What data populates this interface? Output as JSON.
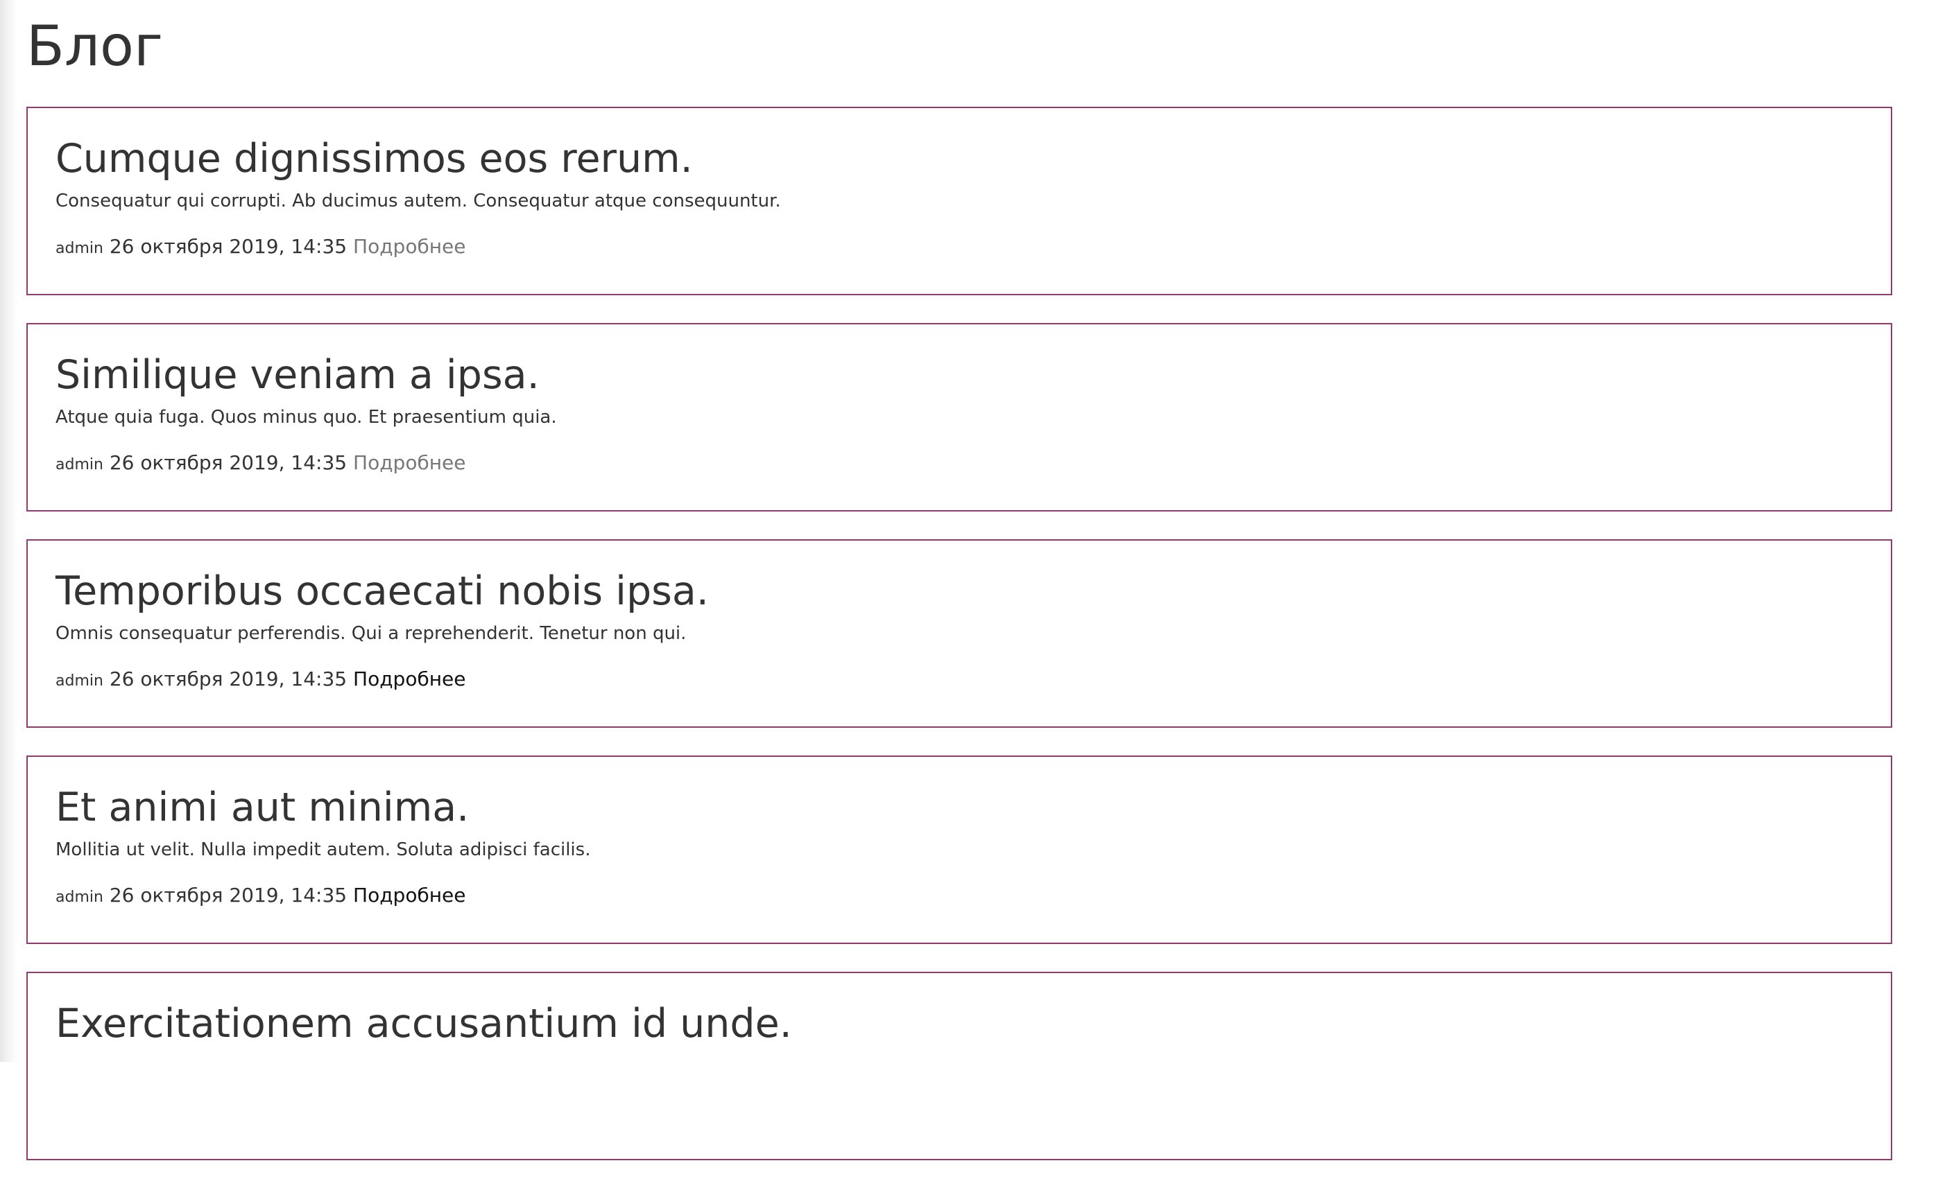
{
  "page": {
    "title": "Блог"
  },
  "posts": [
    {
      "title": "Cumque dignissimos eos rerum.",
      "excerpt": "Consequatur qui corrupti. Ab ducimus autem. Consequatur atque consequuntur.",
      "author": "admin",
      "date": "26 октября 2019, 14:35",
      "more_label": "Подробнее",
      "more_color": "#777777"
    },
    {
      "title": "Similique veniam a ipsa.",
      "excerpt": "Atque quia fuga. Quos minus quo. Et praesentium quia.",
      "author": "admin",
      "date": "26 октября 2019, 14:35",
      "more_label": "Подробнее",
      "more_color": "#777777"
    },
    {
      "title": "Temporibus occaecati nobis ipsa.",
      "excerpt": "Omnis consequatur perferendis. Qui a reprehenderit. Tenetur non qui.",
      "author": "admin",
      "date": "26 октября 2019, 14:35",
      "more_label": "Подробнее",
      "more_color": "#111111"
    },
    {
      "title": "Et animi aut minima.",
      "excerpt": "Mollitia ut velit. Nulla impedit autem. Soluta adipisci facilis.",
      "author": "admin",
      "date": "26 октября 2019, 14:35",
      "more_label": "Подробнее",
      "more_color": "#111111"
    },
    {
      "title": "Exercitationem accusantium id unde.",
      "excerpt": "",
      "author": "",
      "date": "",
      "more_label": "",
      "more_color": "#111111"
    }
  ],
  "colors": {
    "card_border": "#8e3c6d",
    "text": "#333333"
  }
}
